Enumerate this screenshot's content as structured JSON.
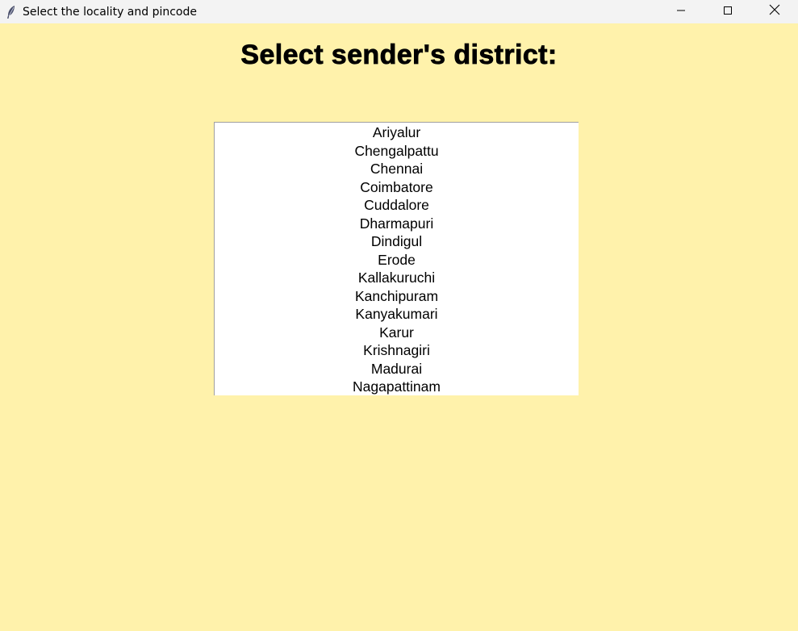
{
  "window": {
    "title": "Select the locality and pincode",
    "icon": "feather-icon",
    "controls": [
      "minimize-icon",
      "maximize-icon",
      "close-icon"
    ]
  },
  "main": {
    "heading": "Select sender's district:",
    "districts": [
      "Ariyalur",
      "Chengalpattu",
      "Chennai",
      "Coimbatore",
      "Cuddalore",
      "Dharmapuri",
      "Dindigul",
      "Erode",
      "Kallakuruchi",
      "Kanchipuram",
      "Kanyakumari",
      "Karur",
      "Krishnagiri",
      "Madurai",
      "Nagapattinam"
    ]
  },
  "colors": {
    "background": "#fff2ab",
    "titlebar": "#f3f3f3",
    "listbox": "#ffffff"
  }
}
